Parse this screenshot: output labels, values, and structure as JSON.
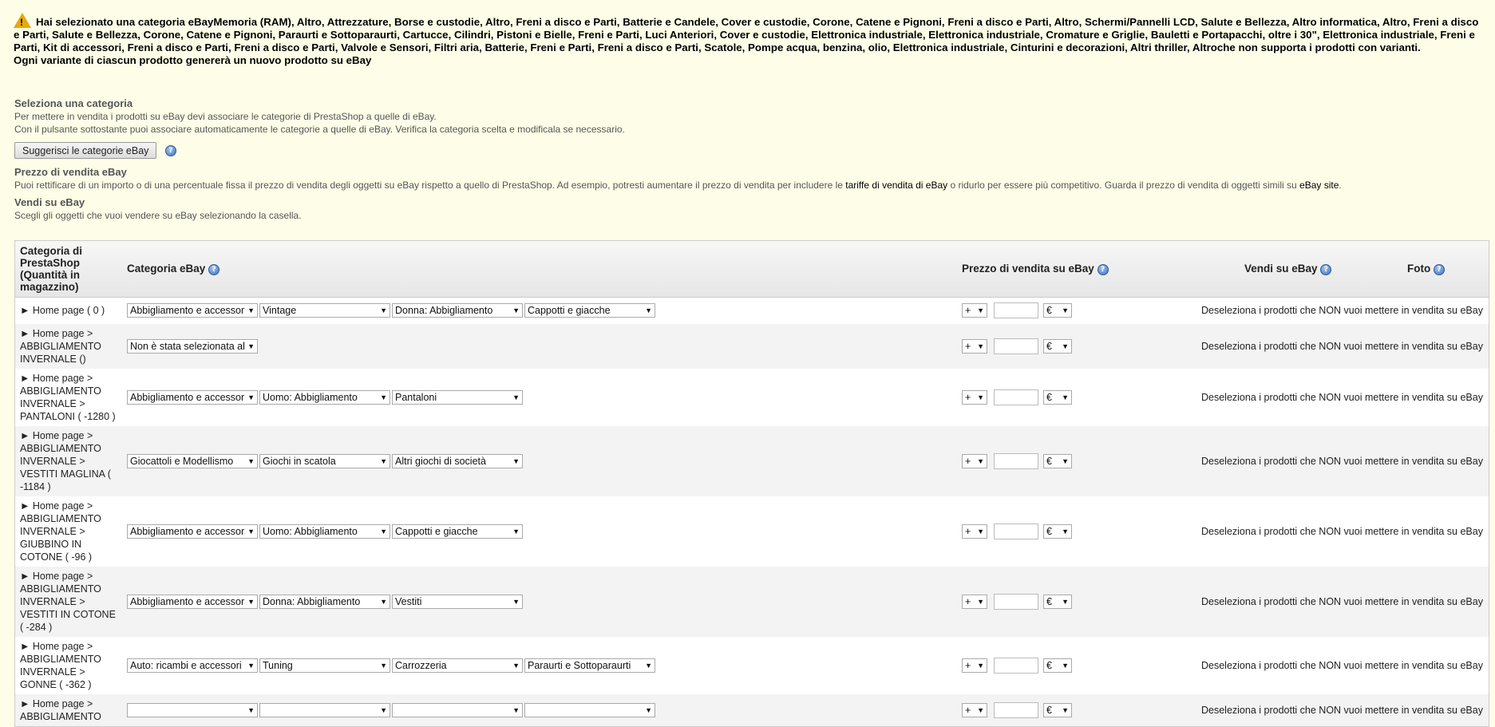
{
  "warning": {
    "icon": "warning-icon",
    "text": "Hai selezionato una categoria eBayMemoria (RAM), Altro, Attrezzature, Borse e custodie, Altro, Freni a disco e Parti, Batterie e Candele, Cover e custodie, Corone, Catene e Pignoni, Freni a disco e Parti, Altro, Schermi/Pannelli LCD, Salute e Bellezza, Altro informatica, Altro, Freni a disco e Parti, Salute e Bellezza, Corone, Catene e Pignoni, Paraurti e Sottoparaurti, Cartucce, Cilindri, Pistoni e Bielle, Freni e Parti, Luci Anteriori, Cover e custodie, Elettronica industriale, Elettronica industriale, Cromature e Griglie, Bauletti e Portapacchi, oltre i 30\", Elettronica industriale, Freni e Parti, Kit di accessori, Freni a disco e Parti, Freni a disco e Parti, Valvole e Sensori, Filtri aria, Batterie, Freni e Parti, Freni a disco e Parti, Scatole, Pompe acqua, benzina, olio, Elettronica industriale, Cinturini e decorazioni, Altri thriller, Altroche non supporta i prodotti con varianti.",
    "text2": "Ogni variante di ciascun prodotto genererà un nuovo prodotto su eBay"
  },
  "select_category": {
    "title": "Seleziona una categoria",
    "line1": "Per mettere in vendita i prodotti su eBay devi associare le categorie di PrestaShop a quelle di eBay.",
    "line2": "Con il pulsante sottostante puoi associare automaticamente le categorie a quelle di eBay. Verifica la categoria scelta e modificala se necessario.",
    "button": "Suggerisci le categorie eBay"
  },
  "price": {
    "title": "Prezzo di vendita eBay",
    "text_a": "Puoi rettificare di un importo o di una percentuale fissa il prezzo di vendita degli oggetti su eBay rispetto a quello di PrestaShop. Ad esempio, potresti aumentare il prezzo di vendita per includere le ",
    "link1": "tariffe di vendita di eBay",
    "text_b": " o ridurlo per essere più competitivo. Guarda il prezzo di vendita di oggetti simili su ",
    "link2": "eBay site",
    "text_c": "."
  },
  "sell": {
    "title": "Vendi su eBay",
    "text": "Scegli gli oggetti che vuoi vendere su eBay selezionando la casella."
  },
  "table": {
    "headers": {
      "category": "Categoria di PrestaShop (Quantità in magazzino)",
      "ebay_category": "Categoria eBay",
      "price": "Prezzo di vendita su eBay",
      "sell": "Vendi su eBay",
      "photo": "Foto"
    },
    "op_value": "+",
    "currency": "€",
    "vendi_text": "Deseleziona i prodotti che NON vuoi mettere in vendita su eBay",
    "rows": [
      {
        "cat": "► Home page ( 0 )",
        "sel": [
          "Abbigliamento e accessor",
          "Vintage",
          "Donna: Abbigliamento",
          "Cappotti e giacche"
        ]
      },
      {
        "cat": "► Home page > ABBIGLIAMENTO INVERNALE ()",
        "sel": [
          "Non è stata selezionata al"
        ]
      },
      {
        "cat": "► Home page > ABBIGLIAMENTO INVERNALE > PANTALONI ( -1280 )",
        "sel": [
          "Abbigliamento e accessor",
          "Uomo: Abbigliamento",
          "Pantaloni"
        ]
      },
      {
        "cat": "► Home page > ABBIGLIAMENTO INVERNALE > VESTITI MAGLINA ( -1184 )",
        "sel": [
          "Giocattoli e Modellismo",
          "Giochi in scatola",
          "Altri giochi di società"
        ]
      },
      {
        "cat": "► Home page > ABBIGLIAMENTO INVERNALE > GIUBBINO IN COTONE ( -96 )",
        "sel": [
          "Abbigliamento e accessor",
          "Uomo: Abbigliamento",
          "Cappotti e giacche"
        ]
      },
      {
        "cat": "► Home page > ABBIGLIAMENTO INVERNALE > VESTITI IN COTONE ( -284 )",
        "sel": [
          "Abbigliamento e accessor",
          "Donna: Abbigliamento",
          "Vestiti"
        ]
      },
      {
        "cat": "► Home page > ABBIGLIAMENTO INVERNALE > GONNE ( -362 )",
        "sel": [
          "Auto: ricambi e accessori",
          "Tuning",
          "Carrozzeria",
          "Paraurti e Sottoparaurti"
        ]
      },
      {
        "cat": "► Home page > ABBIGLIAMENTO",
        "sel": [
          "",
          "",
          "",
          ""
        ]
      }
    ]
  }
}
